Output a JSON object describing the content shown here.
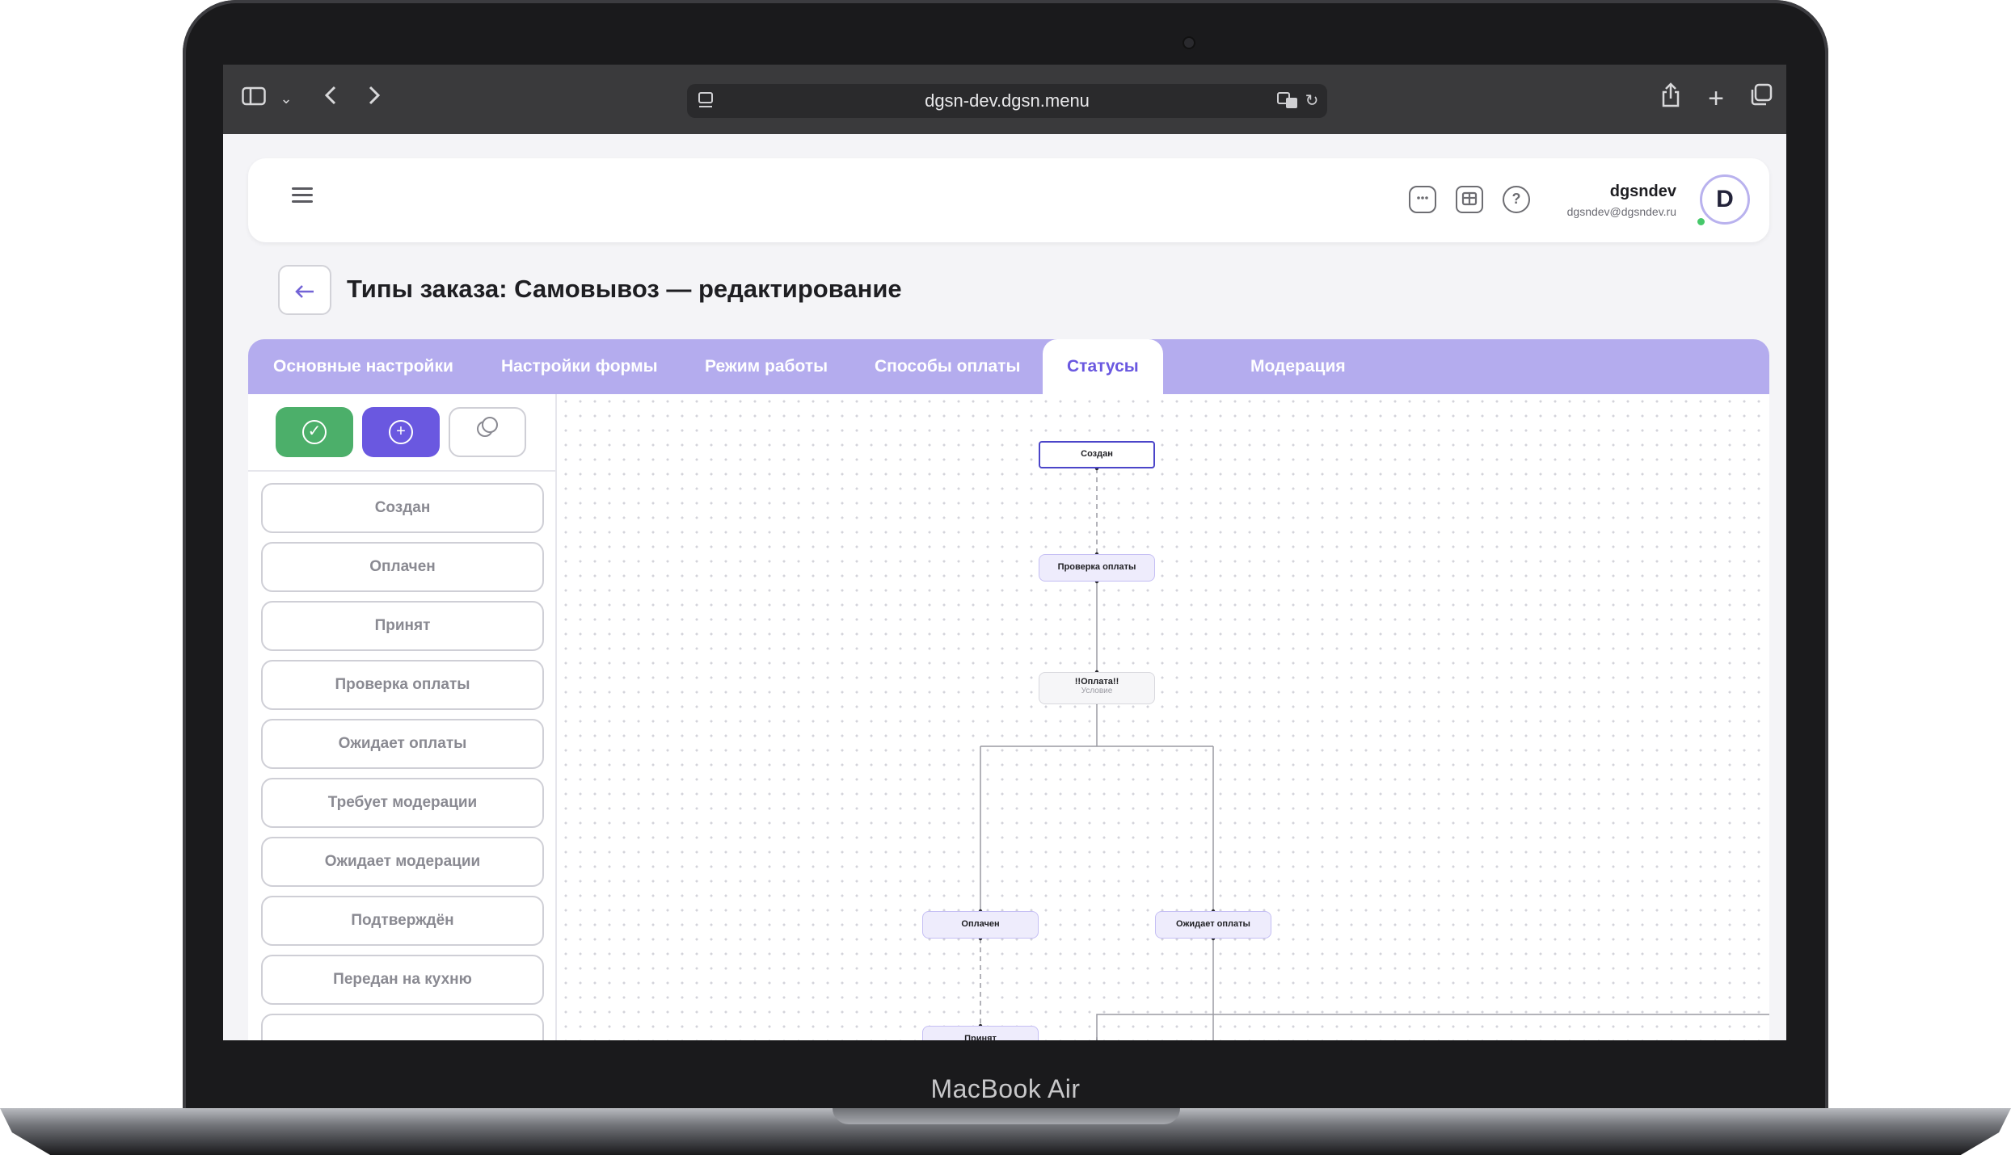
{
  "device": {
    "label": "MacBook Air"
  },
  "browser": {
    "url": "dgsn-dev.dgsn.menu",
    "icons": [
      "sidebar-icon",
      "chevron-down-icon",
      "back-arrow-icon",
      "forward-arrow-icon",
      "page-icon",
      "translate-icon",
      "reload-icon",
      "share-icon",
      "plus-icon",
      "tabs-icon"
    ]
  },
  "header": {
    "icons": [
      "chat-icon",
      "store-icon",
      "help-icon"
    ],
    "user": {
      "name": "dgsndev",
      "email": "dgsndev@dgsndev.ru",
      "avatar_letter": "D",
      "online": true
    }
  },
  "page": {
    "title": "Типы заказа: Самовывоз — редактирование"
  },
  "tabs": [
    {
      "label": "Основные настройки",
      "active": false
    },
    {
      "label": "Настройки формы",
      "active": false
    },
    {
      "label": "Режим работы",
      "active": false
    },
    {
      "label": "Способы оплаты",
      "active": false
    },
    {
      "label": "Статусы",
      "active": true
    },
    {
      "label": "Модерация",
      "active": false
    }
  ],
  "toolbar": {
    "buttons": [
      {
        "name": "save",
        "icon": "check-circle-icon",
        "color": "#4caf6a"
      },
      {
        "name": "add",
        "icon": "plus-circle-icon",
        "color": "#6a58e0"
      },
      {
        "name": "copy",
        "icon": "copy-icon",
        "color": "#ffffff"
      }
    ]
  },
  "statuses": [
    "Создан",
    "Оплачен",
    "Принят",
    "Проверка оплаты",
    "Ожидает оплаты",
    "Требует модерации",
    "Ожидает модерации",
    "Подтверждён",
    "Передан на кухню"
  ],
  "flow": {
    "nodes": {
      "start": "Создан",
      "check": "Проверка оплаты",
      "condition": "!!Оплата!!",
      "condition_sub": "Условие",
      "paid": "Оплачен",
      "awaiting": "Ожидает оплаты",
      "accepted": "Принят"
    }
  },
  "colors": {
    "accent": "#6a58e0",
    "tabs_bg": "#b4acee",
    "success": "#4caf6a",
    "node_border": "#c5bff4",
    "start_border": "#4b45c9"
  }
}
